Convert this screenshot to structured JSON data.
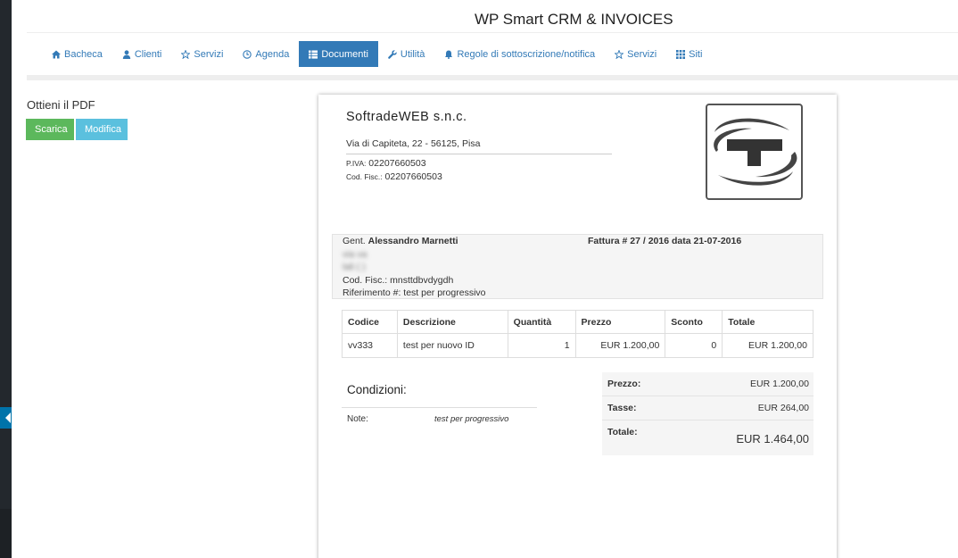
{
  "app": {
    "title": "WP Smart CRM & INVOICES"
  },
  "nav": [
    {
      "label": "Bacheca",
      "icon": "home-icon",
      "active": false
    },
    {
      "label": "Clienti",
      "icon": "user-icon",
      "active": false
    },
    {
      "label": "Servizi",
      "icon": "star-icon",
      "active": false
    },
    {
      "label": "Agenda",
      "icon": "clock-icon",
      "active": false
    },
    {
      "label": "Documenti",
      "icon": "list-icon",
      "active": true
    },
    {
      "label": "Utilità",
      "icon": "wrench-icon",
      "active": false
    },
    {
      "label": "Regole di sottoscrizione/notifica",
      "icon": "bell-icon",
      "active": false
    },
    {
      "label": "Servizi",
      "icon": "star-icon",
      "active": false
    },
    {
      "label": "Siti",
      "icon": "grid-icon",
      "active": false
    }
  ],
  "pdf": {
    "title": "Ottieni il PDF",
    "download_label": "Scarica",
    "edit_label": "Modifica"
  },
  "company": {
    "name": "SoftradeWEB s.n.c.",
    "address": "Via di Capiteta, 22 - 56125, Pisa",
    "piva_label": "P.IVA:",
    "piva": "02207660503",
    "codfisc_label": "Cod. Fisc.:",
    "codfisc": "02207660503"
  },
  "client": {
    "salutation": "Gent.",
    "name": "Alessandro Marnetti",
    "street_blurred": "via va",
    "city_blurred": "lali ( )",
    "codfisc_label": "Cod. Fisc.:",
    "codfisc": "mnsttdbvdygdh",
    "reference_label": "Riferimento #:",
    "reference": "test per progressivo"
  },
  "invoice": {
    "header": "Fattura # 27 / 2016 data 21-07-2016"
  },
  "items": {
    "headers": [
      "Codice",
      "Descrizione",
      "Quantità",
      "Prezzo",
      "Sconto",
      "Totale"
    ],
    "rows": [
      [
        "vv333",
        "test per nuovo ID",
        "1",
        "EUR 1.200,00",
        "0",
        "EUR 1.200,00"
      ]
    ]
  },
  "conditions": {
    "title": "Condizioni:",
    "note_label": "Note:",
    "note_value": "test per progressivo"
  },
  "totals": {
    "price_label": "Prezzo:",
    "price": "EUR 1.200,00",
    "tax_label": "Tasse:",
    "tax": "EUR 264,00",
    "total_label": "Totale:",
    "total": "EUR 1.464,00"
  },
  "colors": {
    "nav_active": "#337ab7",
    "btn_download": "#5cb85c",
    "btn_edit": "#5bc0de",
    "wp_sidebar": "#23282d"
  }
}
